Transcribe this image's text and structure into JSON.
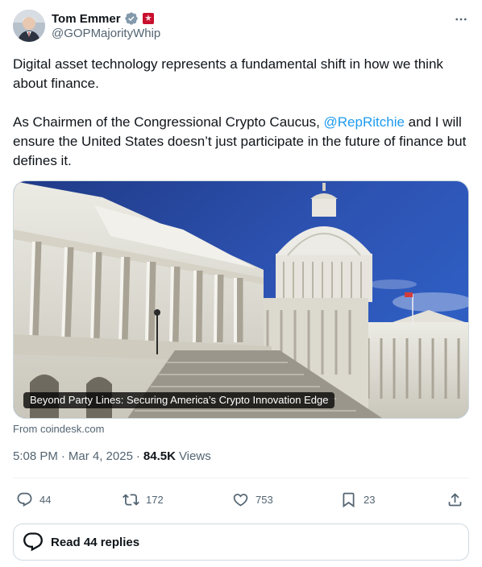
{
  "author": {
    "name": "Tom Emmer",
    "handle": "@GOPMajorityWhip"
  },
  "tweet": {
    "paragraph1": "Digital asset technology represents a fundamental shift in how we think about finance.",
    "paragraph2_before": "As Chairmen of the Congressional Crypto Caucus, ",
    "mention": "@RepRitchie",
    "paragraph2_after": " and I will ensure the United States doesn’t just participate in the future of finance but defines it."
  },
  "card": {
    "title": "Beyond Party Lines: Securing America’s Crypto Innovation Edge",
    "source": "From coindesk.com"
  },
  "meta": {
    "time": "5:08 PM",
    "date": "Mar 4, 2025",
    "separator": "·",
    "views_count": "84.5K",
    "views_label": "Views"
  },
  "actions": {
    "replies": "44",
    "reposts": "172",
    "likes": "753",
    "bookmarks": "23"
  },
  "replies_button": {
    "label": "Read 44 replies"
  },
  "colors": {
    "accent": "#1d9bf0",
    "text": "#0f1419",
    "secondary": "#536471",
    "border": "#cfd9de"
  },
  "icons": [
    "verified-badge-icon",
    "government-affiliation-icon",
    "more-icon",
    "reply-icon",
    "repost-icon",
    "like-icon",
    "bookmark-icon",
    "share-icon",
    "replies-bubble-icon"
  ]
}
